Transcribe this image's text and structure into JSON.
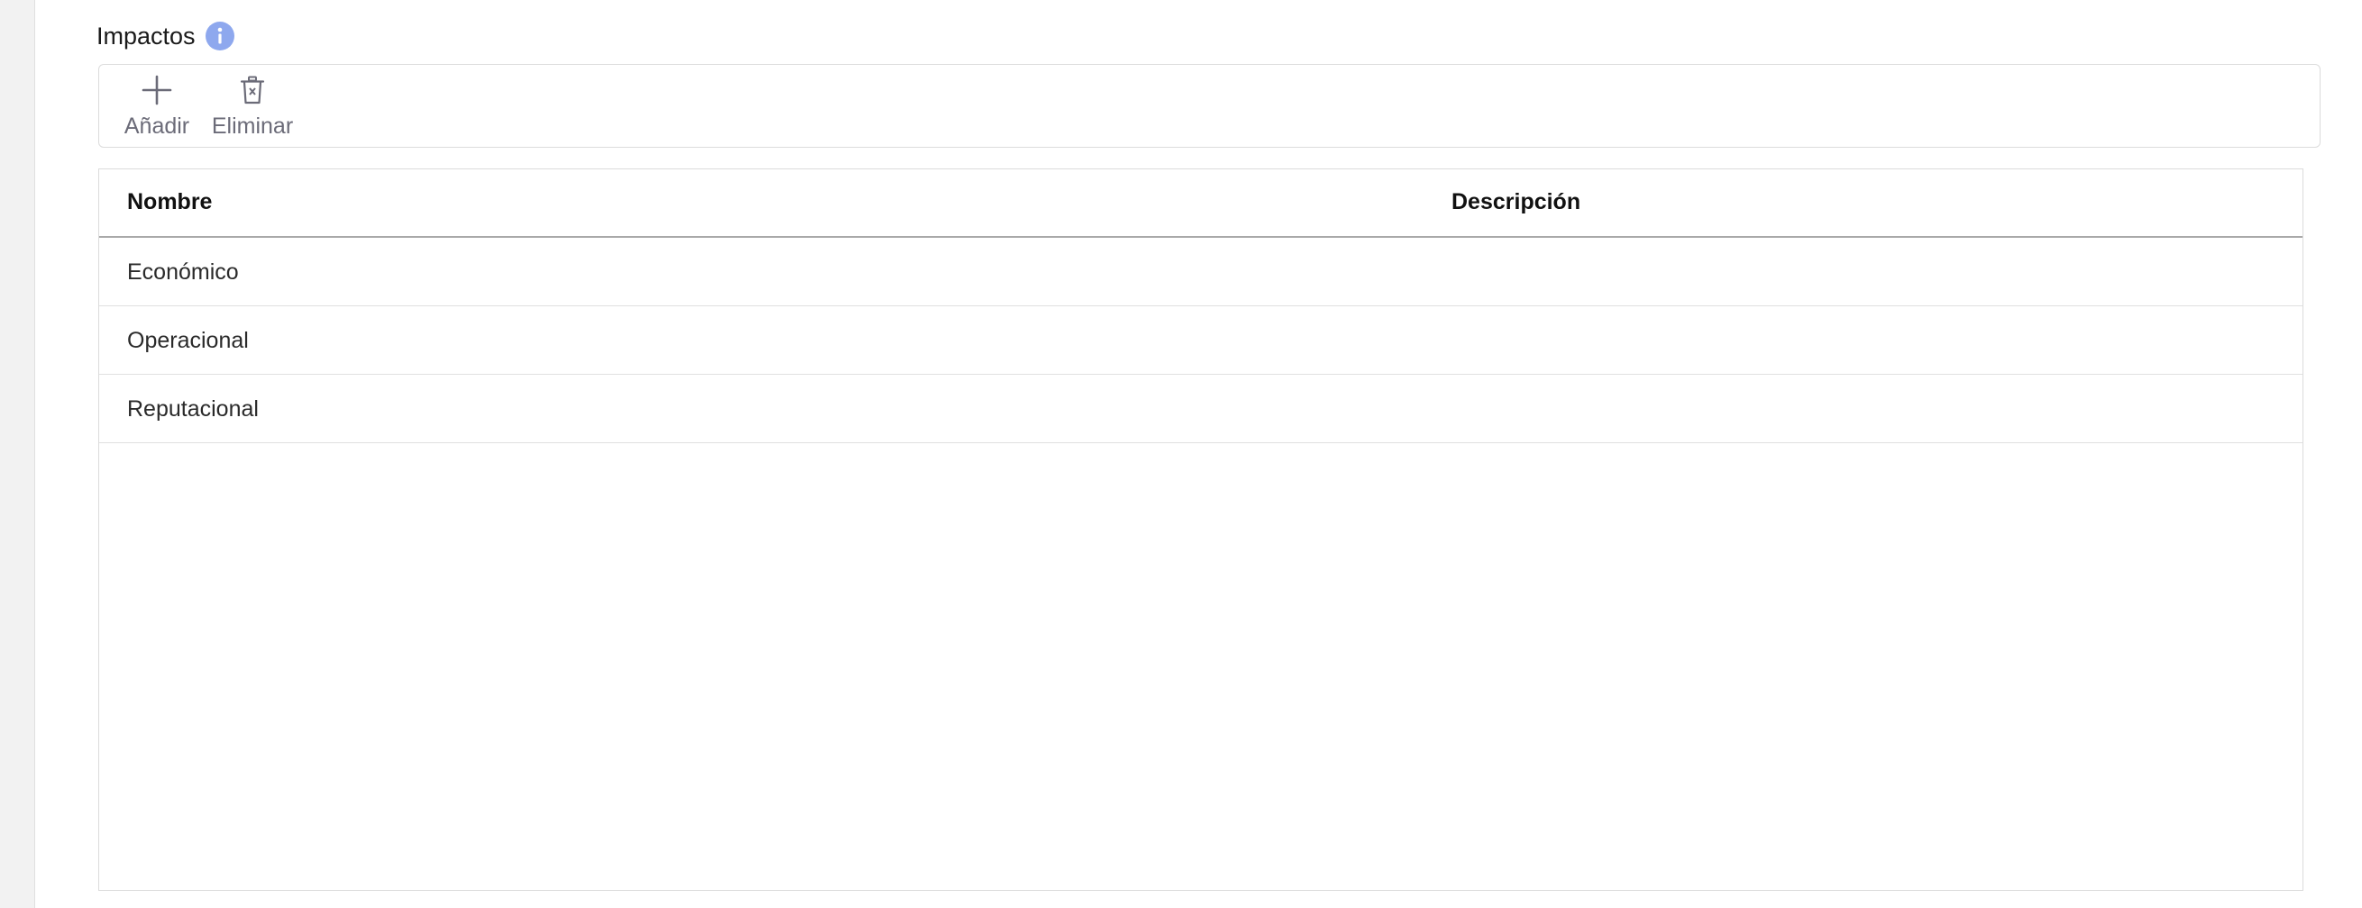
{
  "section": {
    "title": "Impactos",
    "info_icon": "info-icon",
    "info_color": "#8ea8ee"
  },
  "toolbar": {
    "add_label": "Añadir",
    "add_icon": "plus-icon",
    "delete_label": "Eliminar",
    "delete_icon": "trash-icon"
  },
  "table": {
    "columns": [
      "Nombre",
      "Descripción"
    ],
    "rows": [
      {
        "nombre": "Económico",
        "descripcion": ""
      },
      {
        "nombre": "Operacional",
        "descripcion": ""
      },
      {
        "nombre": "Reputacional",
        "descripcion": ""
      }
    ]
  }
}
